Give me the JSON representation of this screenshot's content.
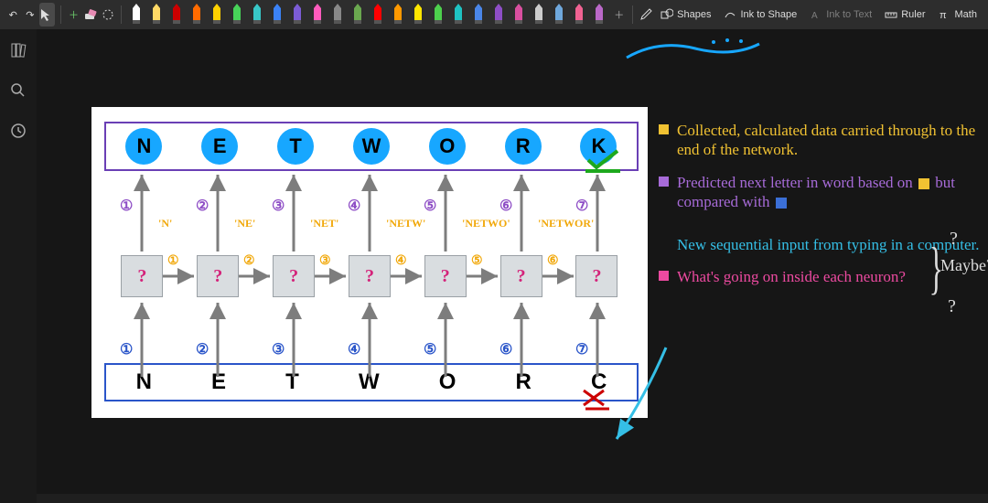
{
  "toolbar": {
    "undo": "↶",
    "redo": "↷",
    "cursor": "✎",
    "addpen": "＋",
    "eraser": "⌫",
    "lasso": "◌",
    "shapes_label": "Shapes",
    "ink_to_shape_label": "Ink to Shape",
    "ink_to_text_label": "Ink to Text",
    "ruler_label": "Ruler",
    "math_label": "Math",
    "pen_colors": [
      "#ffffff",
      "#ffd966",
      "#cc0000",
      "#ff6b00",
      "#ffd100",
      "#47d359",
      "#38c7c7",
      "#3b82f6",
      "#7b5cd6",
      "#ff5bbd",
      "#888888",
      "#6aa84f",
      "#ff0000",
      "#ff9900",
      "#ffe600",
      "#4dd04d",
      "#1fc2c2",
      "#4a86e8",
      "#8e4ec6",
      "#d94f9f",
      "#cccccc",
      "#6fa8dc",
      "#f06292",
      "#ba68c8"
    ]
  },
  "diagram": {
    "top_letters": [
      "N",
      "E",
      "T",
      "W",
      "O",
      "R",
      "K"
    ],
    "bottom_letters": [
      "N",
      "E",
      "T",
      "W",
      "O",
      "R",
      "C"
    ],
    "cell_mark": "?",
    "vnums_top": [
      "①",
      "②",
      "③",
      "④",
      "⑤",
      "⑥",
      "⑦"
    ],
    "hnums": [
      "①",
      "②",
      "③",
      "④",
      "⑤",
      "⑥"
    ],
    "vnums_bot": [
      "①",
      "②",
      "③",
      "④",
      "⑤",
      "⑥",
      "⑦"
    ],
    "hwords": [
      "'N'",
      "'NE'",
      "'NET'",
      "'NETW'",
      "'NETWO'",
      "'NETWOR'"
    ]
  },
  "notes": {
    "n1": "Collected, calculated data carried through to the end of the network.",
    "n2a": "Predicted next letter in word based on ",
    "n2b": " but compared with ",
    "n3": "New sequential input from typing in a computer.",
    "n4": "What's going on inside each neuron?",
    "maybe": "Maybe?",
    "q": "?"
  }
}
